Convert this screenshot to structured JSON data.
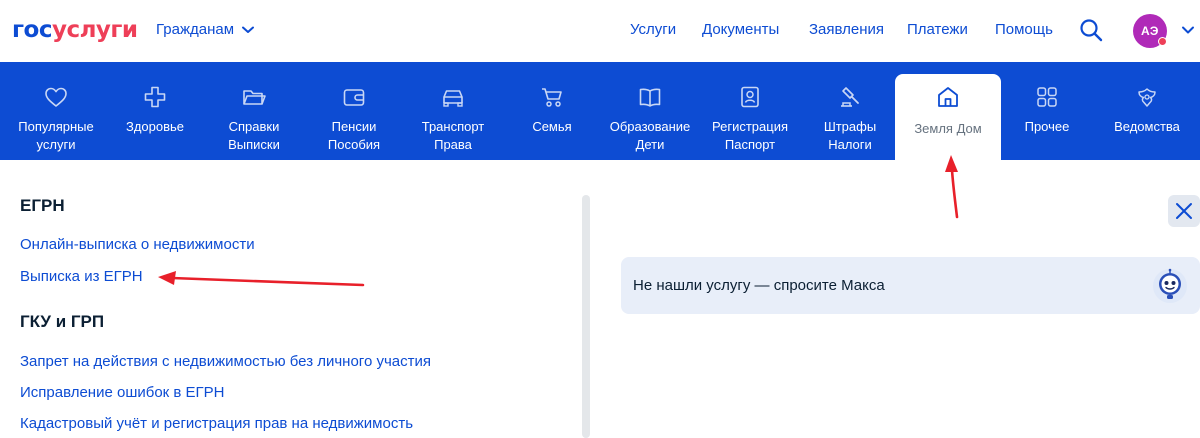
{
  "header": {
    "logo_part1": "гос",
    "logo_part2": "услуги",
    "audience_label": "Гражданам",
    "nav": [
      "Услуги",
      "Документы",
      "Заявления",
      "Платежи",
      "Помощь"
    ],
    "avatar_initials": "АЭ"
  },
  "categories": [
    {
      "label": "Популярные\nуслуги",
      "icon": "heart-icon"
    },
    {
      "label": "Здоровье",
      "icon": "medical-cross-icon"
    },
    {
      "label": "Справки\nВыписки",
      "icon": "folder-icon"
    },
    {
      "label": "Пенсии\nПособия",
      "icon": "wallet-icon"
    },
    {
      "label": "Транспорт\nПрава",
      "icon": "car-icon"
    },
    {
      "label": "Семья",
      "icon": "stroller-icon"
    },
    {
      "label": "Образование\nДети",
      "icon": "book-icon"
    },
    {
      "label": "Регистрация\nПаспорт",
      "icon": "passport-icon"
    },
    {
      "label": "Штрафы\nНалоги",
      "icon": "gavel-icon"
    },
    {
      "label": "Земля Дом",
      "icon": "house-icon",
      "active": true
    },
    {
      "label": "Прочее",
      "icon": "grid-icon"
    },
    {
      "label": "Ведомства",
      "icon": "emblem-icon"
    }
  ],
  "sections": [
    {
      "title": "ЕГРН",
      "links": [
        "Онлайн-выписка о недвижимости",
        "Выписка из ЕГРН"
      ]
    },
    {
      "title": "ГКУ и ГРП",
      "links": [
        "Запрет на действия с недвижимостью без личного участия",
        "Исправление ошибок в ЕГРН",
        "Кадастровый учёт и регистрация прав на недвижимость"
      ]
    }
  ],
  "assistant": {
    "prompt": "Не нашли услугу — спросите Макса"
  },
  "colors": {
    "brand_blue": "#0d4cd3",
    "brand_red": "#ee3f58",
    "annotation": "#e8202a"
  }
}
